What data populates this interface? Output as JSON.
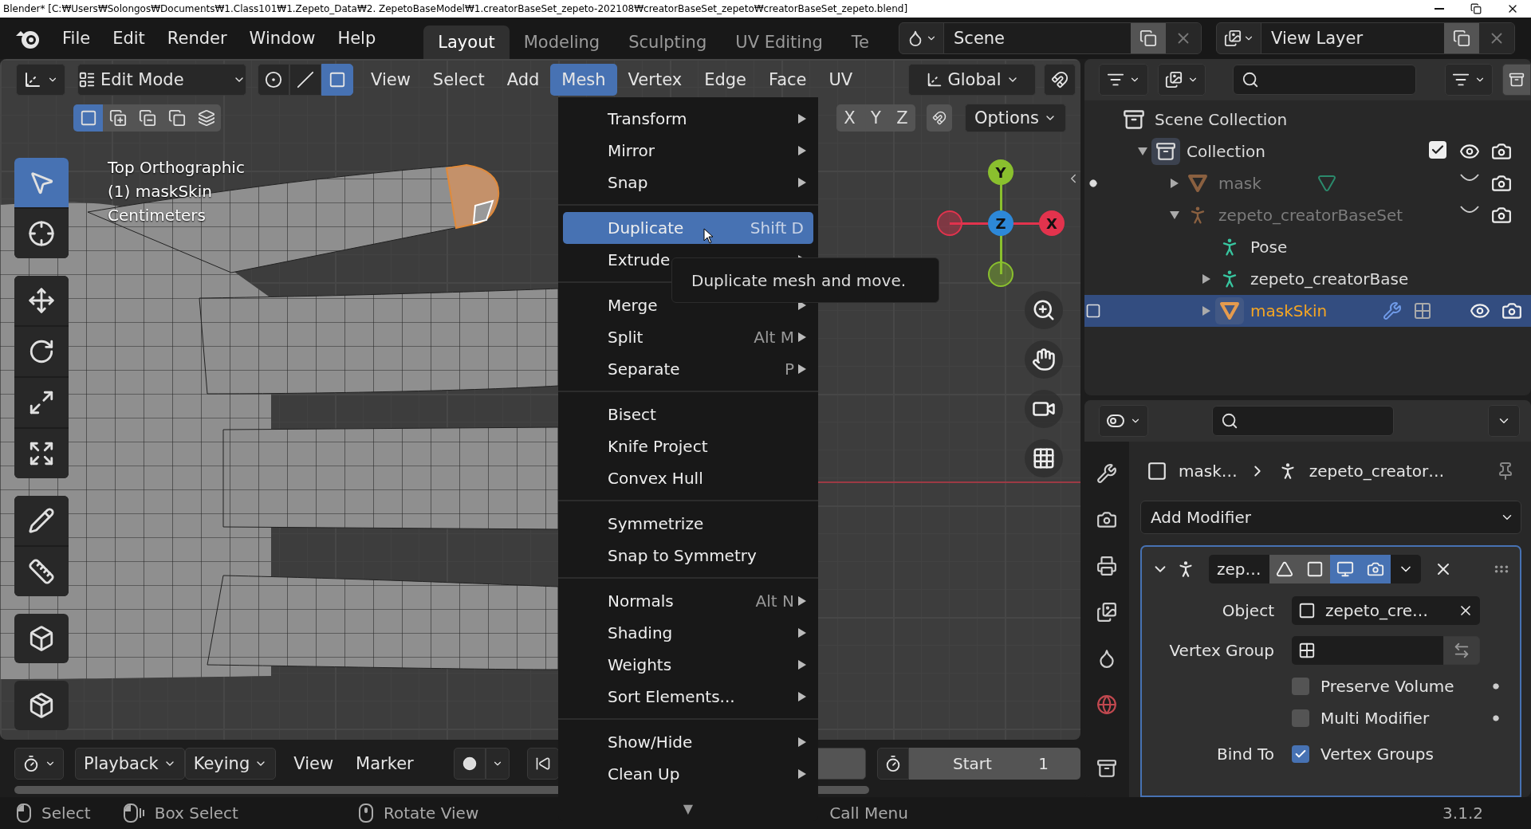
{
  "window": {
    "title": "Blender* [C:₩Users₩Solongos₩Documents₩1.Class101₩1.Zepeto_Data₩2. ZepetoBaseModel₩1.creatorBaseSet_zepeto-202108₩creatorBaseSet_zepeto₩creatorBaseSet_zepeto.blend]"
  },
  "menubar": [
    "File",
    "Edit",
    "Render",
    "Window",
    "Help"
  ],
  "workspaces": [
    {
      "label": "Layout",
      "selected": true
    },
    {
      "label": "Modeling",
      "selected": false
    },
    {
      "label": "Sculpting",
      "selected": false
    },
    {
      "label": "UV Editing",
      "selected": false
    },
    {
      "label": "Te",
      "selected": false
    }
  ],
  "scene": "Scene",
  "view_layer": "View Layer",
  "viewport_header": {
    "mode": "Edit Mode",
    "select_modes": [
      {
        "kind": "vertex",
        "selected": false
      },
      {
        "kind": "edge",
        "selected": false
      },
      {
        "kind": "face",
        "selected": true
      }
    ],
    "menus": [
      {
        "label": "View",
        "selected": false
      },
      {
        "label": "Select",
        "selected": false
      },
      {
        "label": "Add",
        "selected": false
      },
      {
        "label": "Mesh",
        "selected": true
      },
      {
        "label": "Vertex",
        "selected": false
      },
      {
        "label": "Edge",
        "selected": false
      },
      {
        "label": "Face",
        "selected": false
      },
      {
        "label": "UV",
        "selected": false
      }
    ],
    "orientation": "Global"
  },
  "tool_header": {
    "selection_ops": [
      {
        "kind": "set",
        "selected": true
      },
      {
        "kind": "extend",
        "selected": false
      },
      {
        "kind": "subtract",
        "selected": false
      },
      {
        "kind": "invert",
        "selected": false
      },
      {
        "kind": "intersect",
        "selected": false
      }
    ],
    "axes": [
      "X",
      "Y",
      "Z"
    ],
    "options": "Options"
  },
  "viewport": {
    "info": [
      "Top Orthographic",
      "(1) maskSkin",
      "Centimeters"
    ],
    "tool_groups": [
      [
        {
          "kind": "select_box",
          "selected": true
        },
        {
          "kind": "cursor",
          "selected": false
        }
      ],
      [
        {
          "kind": "move",
          "selected": false
        },
        {
          "kind": "rotate",
          "selected": false
        },
        {
          "kind": "scale",
          "selected": false
        },
        {
          "kind": "transform",
          "selected": false
        }
      ],
      [
        {
          "kind": "annotate",
          "selected": false
        },
        {
          "kind": "measure",
          "selected": false
        }
      ],
      [
        {
          "kind": "add_cube",
          "selected": false
        }
      ],
      [
        {
          "kind": "extrude",
          "selected": false
        }
      ]
    ],
    "gizmo": [
      {
        "label": "Y",
        "color": "#8ac02e"
      },
      {
        "label": "Z",
        "color": "#2d88d8"
      },
      {
        "label": "X",
        "color": "#e2334d"
      }
    ]
  },
  "mesh_menu": {
    "groups": [
      [
        {
          "label": "Transform",
          "submenu": true,
          "selected": false
        },
        {
          "label": "Mirror",
          "submenu": true,
          "selected": false
        },
        {
          "label": "Snap",
          "submenu": true,
          "selected": false
        }
      ],
      [
        {
          "label": "Duplicate",
          "shortcut": "Shift D",
          "submenu": false,
          "selected": true
        },
        {
          "label": "Extrude",
          "submenu": true,
          "selected": false
        }
      ],
      [
        {
          "label": "Merge",
          "submenu": true,
          "selected": false
        },
        {
          "label": "Split",
          "shortcut": "Alt M",
          "submenu": true,
          "selected": false
        },
        {
          "label": "Separate",
          "shortcut": "P",
          "submenu": true,
          "selected": false
        }
      ],
      [
        {
          "label": "Bisect",
          "submenu": false,
          "selected": false
        },
        {
          "label": "Knife Project",
          "submenu": false,
          "selected": false
        },
        {
          "label": "Convex Hull",
          "submenu": false,
          "selected": false
        }
      ],
      [
        {
          "label": "Symmetrize",
          "submenu": false,
          "selected": false
        },
        {
          "label": "Snap to Symmetry",
          "submenu": false,
          "selected": false
        }
      ],
      [
        {
          "label": "Normals",
          "shortcut": "Alt N",
          "submenu": true,
          "selected": false
        },
        {
          "label": "Shading",
          "submenu": true,
          "selected": false
        },
        {
          "label": "Weights",
          "submenu": true,
          "selected": false
        },
        {
          "label": "Sort Elements...",
          "submenu": true,
          "selected": false
        }
      ],
      [
        {
          "label": "Show/Hide",
          "submenu": true,
          "selected": false
        },
        {
          "label": "Clean Up",
          "submenu": true,
          "selected": false
        }
      ]
    ],
    "more": "▼"
  },
  "tooltip": "Duplicate mesh and move.",
  "timeline": {
    "menus": [
      {
        "label": "Playback",
        "dropdown": true
      },
      {
        "label": "Keying",
        "dropdown": true
      },
      {
        "label": "View",
        "dropdown": false
      },
      {
        "label": "Marker",
        "dropdown": false
      }
    ],
    "start_label": "Start",
    "start_value": "1"
  },
  "status_bar": {
    "hints": [
      {
        "kind": "left_click",
        "label": "Select"
      },
      {
        "kind": "drag",
        "label": "Box Select"
      },
      {
        "kind": "middle_click",
        "label": "Rotate View"
      },
      {
        "label": "Call Menu"
      }
    ],
    "version": "3.1.2"
  },
  "outliner": {
    "tree": [
      {
        "label": "Scene Collection",
        "kind": "scene_collection",
        "selected": false,
        "children": [
          {
            "label": "Collection",
            "kind": "collection",
            "expanded": true,
            "checked": true,
            "visible": true,
            "selected": false,
            "children": [
              {
                "label": "mask",
                "kind": "mesh",
                "expanded": false,
                "visible": false,
                "selected": false,
                "indicator": {
                  "kind": "dot"
                },
                "extras": [
                  {
                    "kind": "mesh_data"
                  }
                ]
              },
              {
                "label": "zepeto_creatorBaseSet",
                "kind": "armature",
                "expanded": true,
                "visible": false,
                "selected": false,
                "children": [
                  {
                    "label": "Pose",
                    "kind": "pose",
                    "selected": false
                  },
                  {
                    "label": "zepeto_creatorBase",
                    "kind": "armature_data",
                    "expanded": false,
                    "selected": false
                  },
                  {
                    "label": "maskSkin",
                    "kind": "mesh",
                    "expanded": false,
                    "visible": true,
                    "selected": true,
                    "indicator": {
                      "kind": "edit"
                    },
                    "extras": [
                      {
                        "kind": "modifier"
                      },
                      {
                        "kind": "vertex_groups"
                      }
                    ]
                  }
                ]
              }
            ]
          }
        ]
      }
    ]
  },
  "properties": {
    "tabs": [
      {
        "kind": "tool",
        "selected": false
      },
      {
        "kind": "render",
        "selected": false
      },
      {
        "kind": "output",
        "selected": false
      },
      {
        "kind": "view_layer",
        "selected": false
      },
      {
        "kind": "scene",
        "selected": false
      },
      {
        "kind": "world",
        "selected": false
      },
      {
        "kind": "collection",
        "selected": false
      }
    ],
    "breadcrumb": [
      "mask…",
      "zepeto_creator…"
    ],
    "add_modifier": "Add Modifier",
    "modifier": {
      "name": "zep…",
      "expanded": true,
      "toggles": [
        {
          "kind": "on_cage",
          "on": false
        },
        {
          "kind": "edit_mode",
          "on": false
        },
        {
          "kind": "viewport",
          "on": true
        },
        {
          "kind": "render",
          "on": true
        }
      ],
      "fields": [
        {
          "kind": "object",
          "label": "Object",
          "value": "zepeto_cre…"
        },
        {
          "kind": "vertex_group",
          "label": "Vertex Group"
        }
      ],
      "options": [
        {
          "label": "Preserve Volume",
          "checked": false
        },
        {
          "label": "Multi Modifier",
          "checked": false
        }
      ],
      "bind": {
        "label": "Bind To",
        "option": "Vertex Groups",
        "checked": true
      }
    }
  }
}
